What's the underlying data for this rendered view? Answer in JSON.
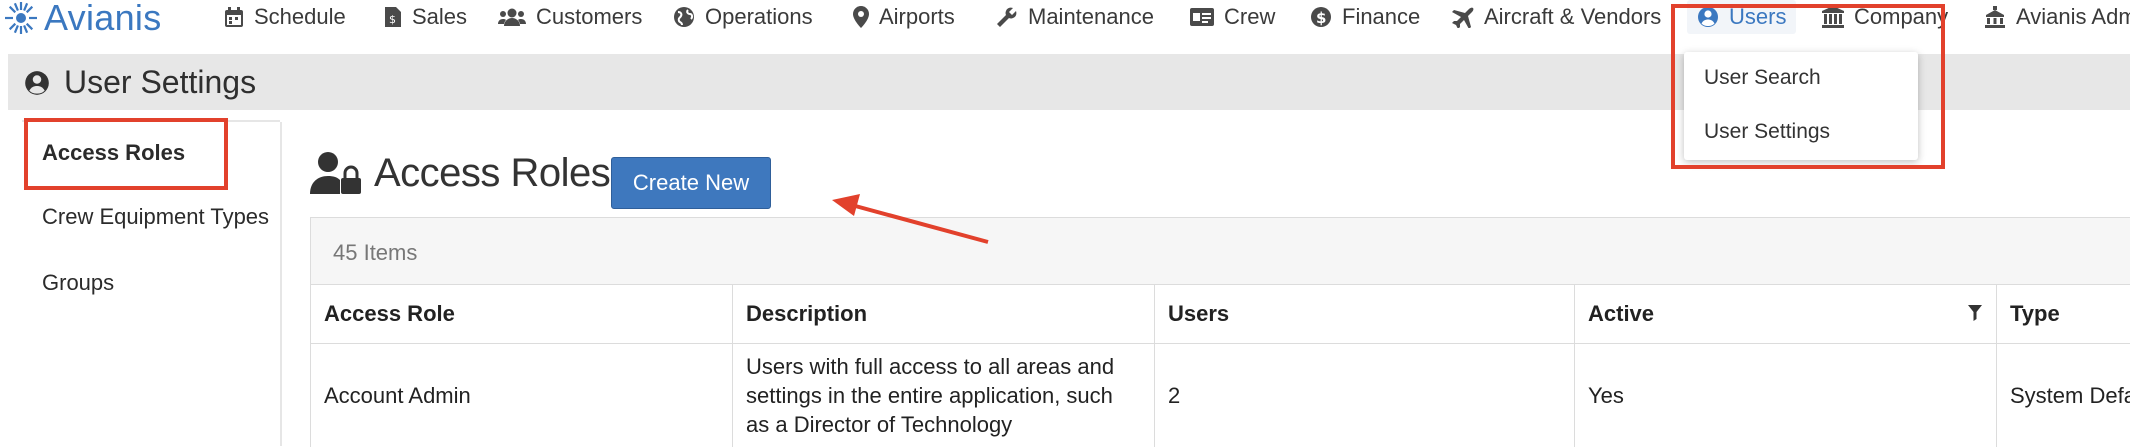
{
  "brand": {
    "name": "Avianis",
    "color": "#3b78c0"
  },
  "nav": {
    "items": [
      {
        "label": "Schedule",
        "icon": "calendar-icon"
      },
      {
        "label": "Sales",
        "icon": "document-dollar-icon"
      },
      {
        "label": "Customers",
        "icon": "users-group-icon"
      },
      {
        "label": "Operations",
        "icon": "globe-icon"
      },
      {
        "label": "Airports",
        "icon": "map-pin-icon"
      },
      {
        "label": "Maintenance",
        "icon": "wrench-icon"
      },
      {
        "label": "Crew",
        "icon": "id-card-icon"
      },
      {
        "label": "Finance",
        "icon": "dollar-circle-icon"
      },
      {
        "label": "Aircraft & Vendors",
        "icon": "plane-icon"
      },
      {
        "label": "Users",
        "icon": "user-circle-icon"
      },
      {
        "label": "Company",
        "icon": "building-icon"
      },
      {
        "label": "Avianis Admin",
        "icon": "landmark-icon"
      }
    ],
    "active": "Users"
  },
  "users_menu": {
    "items": [
      "User Search",
      "User Settings"
    ]
  },
  "page": {
    "title": "User Settings"
  },
  "sidebar": {
    "items": [
      "Access Roles",
      "Crew Equipment Types",
      "Groups"
    ],
    "active": "Access Roles"
  },
  "main": {
    "title": "Access Roles",
    "create_label": "Create New",
    "item_count": "45 Items",
    "columns": [
      "Access Role",
      "Description",
      "Users",
      "Active",
      "Type"
    ],
    "rows": [
      {
        "access_role": "Account Admin",
        "description_lines": [
          "Users with full access to all areas and",
          "settings in the entire application, such",
          "as a Director of Technology"
        ],
        "users": "2",
        "active": "Yes",
        "type": "System Default"
      }
    ]
  },
  "colors": {
    "primary_button": "#3e78be",
    "annotation_red": "#e2412c",
    "header_band": "#e7e7e7"
  }
}
